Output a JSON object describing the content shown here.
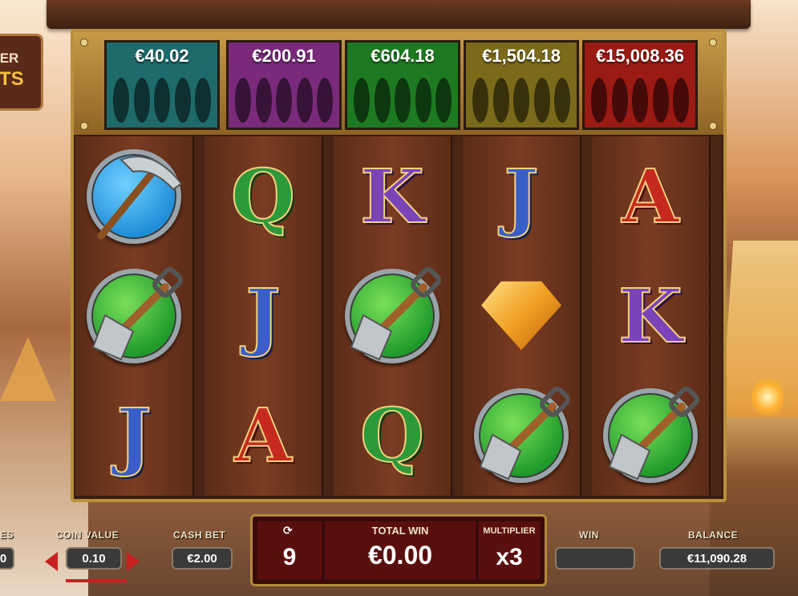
{
  "logo": {
    "line1": "IER",
    "line2": "TS"
  },
  "jackpots": [
    {
      "value": "€40.02",
      "color": "#1f6a6a"
    },
    {
      "value": "€200.91",
      "color": "#7a2a7a"
    },
    {
      "value": "€604.18",
      "color": "#1e7a22"
    },
    {
      "value": "€1,504.18",
      "color": "#7a6a1a"
    },
    {
      "value": "€15,008.36",
      "color": "#9a1a14"
    }
  ],
  "reels": [
    [
      "pickaxe",
      "shovel",
      "J"
    ],
    [
      "Q",
      "J",
      "A"
    ],
    [
      "K",
      "shovel",
      "Q"
    ],
    [
      "J",
      "gem",
      "shovel"
    ],
    [
      "A",
      "K",
      "shovel"
    ]
  ],
  "controls": {
    "lines_label": "ES",
    "lines_value": "0",
    "coin_value_label": "COIN VALUE",
    "coin_value": "0.10",
    "cash_bet_label": "CASH BET",
    "cash_bet": "€2.00",
    "spins_icon": "autoplay-icon",
    "spins_count": "9",
    "total_win_label": "TOTAL WIN",
    "total_win": "€0.00",
    "multiplier_label": "MULTIPLIER",
    "multiplier": "x3",
    "win_label": "WIN",
    "win_value": "",
    "balance_label": "BALANCE",
    "balance": "€11,090.28"
  }
}
